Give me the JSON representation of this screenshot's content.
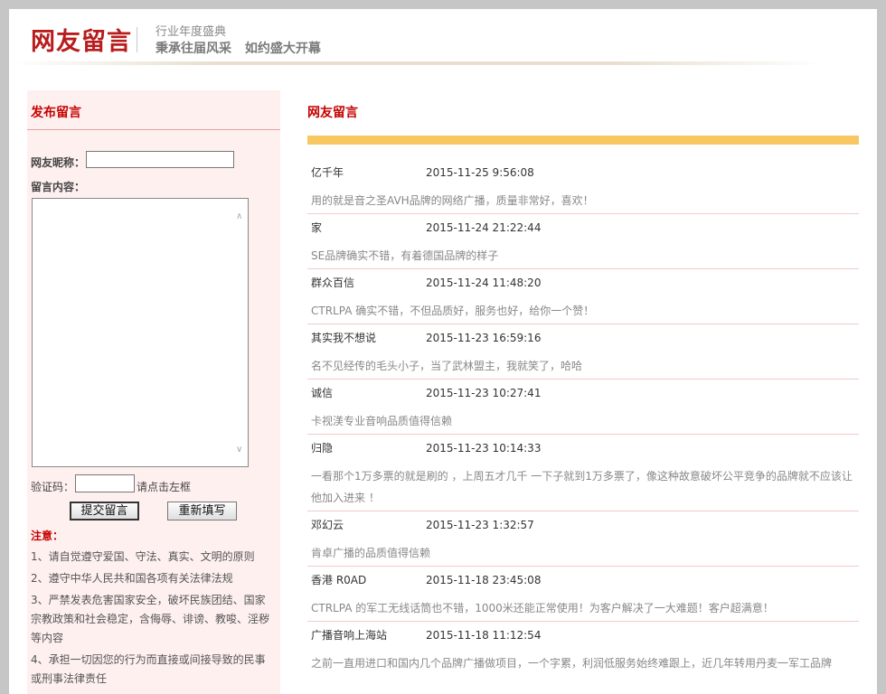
{
  "header": {
    "logo": "网友留言",
    "slogan_line1": "行业年度盛典",
    "slogan_line2": "秉承往届风采 如约盛大开幕"
  },
  "form": {
    "title": "发布留言",
    "nickname_label": "网友昵称：",
    "nickname_value": "",
    "content_label": "留言内容：",
    "content_value": "",
    "code_label": "验证码：",
    "code_value": "",
    "code_hint": "请点击左框",
    "submit_label": "提交留言",
    "reset_label": "重新填写",
    "notice_title": "注意：",
    "notices": [
      "1、请自觉遵守爱国、守法、真实、文明的原则",
      "2、遵守中华人民共和国各项有关法律法规",
      "3、严禁发表危害国家安全，破坏民族团结、国家宗教政策和社会稳定，含侮辱、诽谤、教唆、淫秽等内容",
      "4、承担一切因您的行为而直接或间接导致的民事或刑事法律责任"
    ]
  },
  "messages_title": "网友留言",
  "messages": [
    {
      "name": "亿千年",
      "time": "2015-11-25 9:56:08",
      "content": "用的就是音之圣AVH品牌的网络广播，质量非常好，喜欢！"
    },
    {
      "name": "家",
      "time": "2015-11-24 21:22:44",
      "content": "SE品牌确实不错，有着德国品牌的样子"
    },
    {
      "name": "群众百信",
      "time": "2015-11-24 11:48:20",
      "content": "CTRLPA 确实不错，不但品质好，服务也好，给你一个赞！"
    },
    {
      "name": "其实我不想说",
      "time": "2015-11-23 16:59:16",
      "content": "名不见经传的毛头小子，当了武林盟主，我就笑了，哈哈"
    },
    {
      "name": "诚信",
      "time": "2015-11-23 10:27:41",
      "content": "卡视渼专业音响品质值得信赖"
    },
    {
      "name": "归隐",
      "time": "2015-11-23 10:14:33",
      "content": "一看那个1万多票的就是刷的 ，上周五才几千 一下子就到1万多票了，像这种故意破坏公平竞争的品牌就不应该让他加入进来 ！"
    },
    {
      "name": "邓幻云",
      "time": "2015-11-23 1:32:57",
      "content": "肯卓广播的品质值得信赖"
    },
    {
      "name": "香港 R0AD",
      "time": "2015-11-18 23:45:08",
      "content": "CTRLPA 的军工无线话筒也不错，1000米还能正常使用！为客户解决了一大难题！客户超满意！"
    },
    {
      "name": "广播音响上海站",
      "time": "2015-11-18 11:12:54",
      "content": "之前一直用进口和国内几个品牌广播做项目，一个字累，利润低服务始终难跟上，近几年转用丹麦一军工品牌"
    }
  ]
}
